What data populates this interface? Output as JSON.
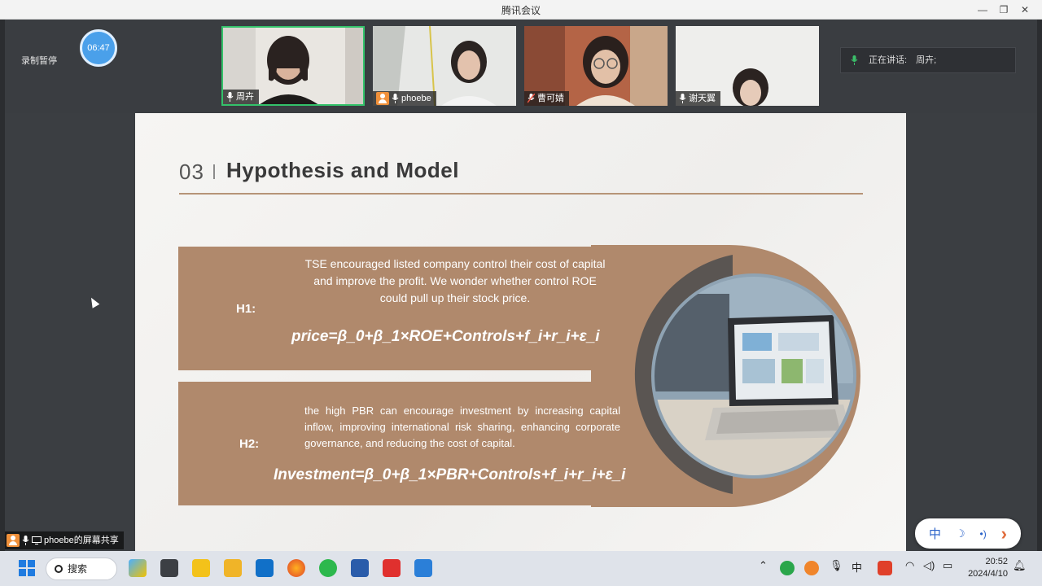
{
  "window": {
    "title": "腾讯会议"
  },
  "meeting": {
    "record_label": "录制暂停",
    "timer": "06:47",
    "speaking_label": "正在讲话:",
    "speaking_name": "周卉;",
    "participants": [
      {
        "name": "周卉",
        "active": true
      },
      {
        "name": "phoebe",
        "active": false
      },
      {
        "name": "曹可婧",
        "active": false
      },
      {
        "name": "谢天翼",
        "active": false
      }
    ],
    "share_label": "phoebe的屏幕共享"
  },
  "slide": {
    "number": "03",
    "title": "Hypothesis and Model",
    "h1": {
      "label": "H1:",
      "text": "TSE encouraged listed company control their cost of capital and improve the profit. We wonder whether control ROE could pull up their stock price.",
      "formula": "price=β_0+β_1×ROE+Controls+f_i+r_i+ε_i"
    },
    "h2": {
      "label": "H2:",
      "text": "the high PBR can encourage investment by increasing capital inflow, improving international risk sharing, enhancing corporate governance, and reducing the cost of capital.",
      "formula": "Investment=β_0+β_1×PBR+Controls+f_i+r_i+ε_i"
    },
    "colors": {
      "band": "#b0896c",
      "ring_dark": "#5a5552",
      "rule": "#b69477"
    }
  },
  "ime": {
    "mode": "中",
    "moon": "☽",
    "dots": "•)",
    "arrow": "›"
  },
  "taskbar": {
    "search_label": "搜索",
    "tray_lang": "中",
    "time": "20:52",
    "date": "2024/4/10"
  }
}
